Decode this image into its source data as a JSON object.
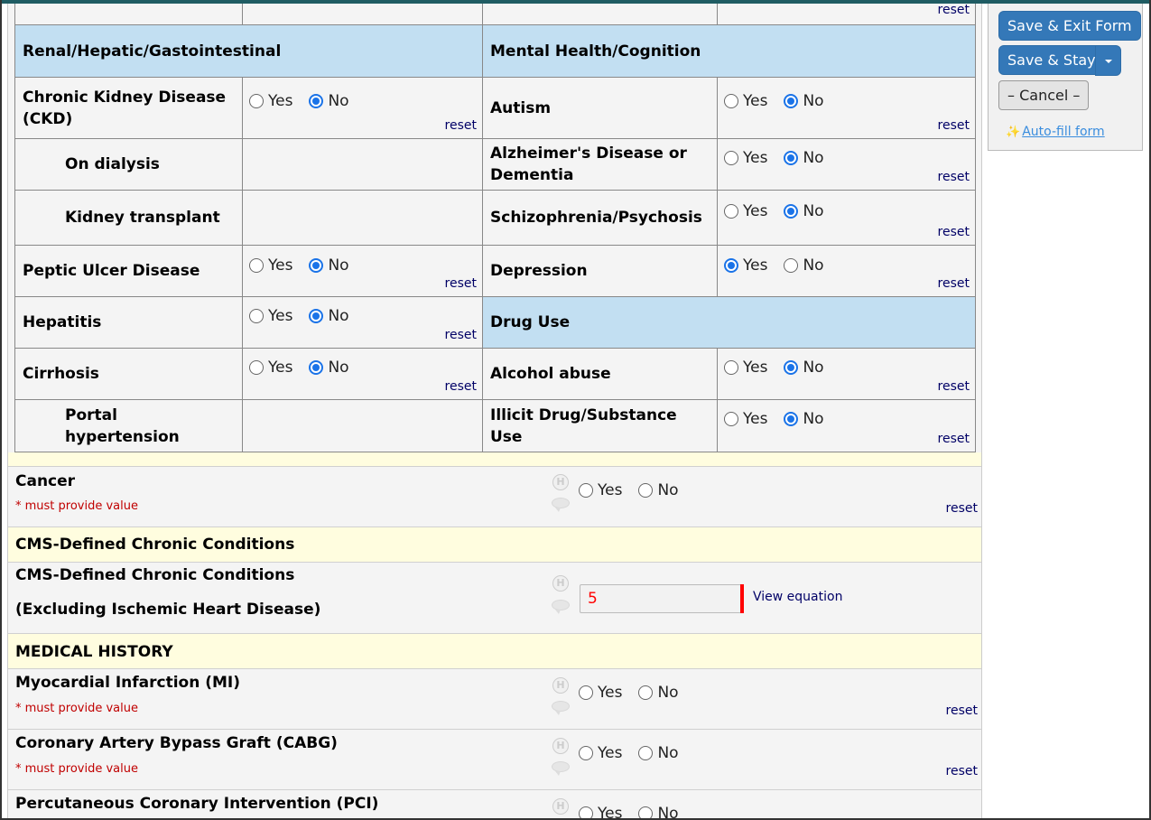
{
  "matrix": {
    "left_header": "Renal/Hepatic/Gastointestinal",
    "right_header": "Mental Health/Cognition",
    "drug_header": "Drug Use",
    "yes_label": "Yes",
    "no_label": "No",
    "reset_label": "reset",
    "left_rows": [
      {
        "label": "Chronic Kidney Disease (CKD)",
        "value": "No",
        "has_options": true,
        "indent": false
      },
      {
        "label": "On dialysis",
        "value": "",
        "has_options": false,
        "indent": true
      },
      {
        "label": "Kidney transplant",
        "value": "",
        "has_options": false,
        "indent": true
      },
      {
        "label": "Peptic Ulcer Disease",
        "value": "No",
        "has_options": true,
        "indent": false
      },
      {
        "label": "Hepatitis",
        "value": "No",
        "has_options": true,
        "indent": false
      },
      {
        "label": "Cirrhosis",
        "value": "No",
        "has_options": true,
        "indent": false
      },
      {
        "label": "Portal hypertension",
        "value": "",
        "has_options": false,
        "indent": true
      }
    ],
    "right_rows": [
      {
        "label": "Autism",
        "value": "No"
      },
      {
        "label": "Alzheimer's Disease or Dementia",
        "value": "No"
      },
      {
        "label": "Schizophrenia/Psychosis",
        "value": "No"
      },
      {
        "label": "Depression",
        "value": "Yes"
      }
    ],
    "drug_rows": [
      {
        "label": "Alcohol abuse",
        "value": "No"
      },
      {
        "label": "Illicit Drug/Substance Use",
        "value": "No"
      }
    ]
  },
  "fields": {
    "cancer": {
      "label": "Cancer",
      "required": "* must provide value",
      "yes": "Yes",
      "no": "No",
      "reset": "reset",
      "value": ""
    },
    "cms_section": "CMS-Defined Chronic Conditions",
    "cms_calc": {
      "label_line1": "CMS-Defined Chronic Conditions",
      "label_line2": "(Excluding Ischemic Heart Disease)",
      "value": "5",
      "view_equation": "View equation"
    },
    "med_history_section": "MEDICAL HISTORY",
    "mi": {
      "label": "Myocardial Infarction (MI)",
      "required": "* must provide value",
      "yes": "Yes",
      "no": "No",
      "reset": "reset",
      "value": ""
    },
    "cabg": {
      "label": "Coronary Artery Bypass Graft (CABG)",
      "required": "* must provide value",
      "yes": "Yes",
      "no": "No",
      "reset": "reset",
      "value": ""
    },
    "pci": {
      "label": "Percutaneous Coronary Intervention (PCI)",
      "yes": "Yes",
      "no": "No",
      "value": ""
    }
  },
  "panel": {
    "save_exit": "Save & Exit Form",
    "save_stay": "Save & Stay",
    "cancel": "– Cancel –",
    "autofill": "Auto-fill form"
  },
  "colors": {
    "matrix_header_bg": "#c2dff2",
    "section_bg": "#fffddf",
    "button_blue": "#3478b8",
    "radio_selected": "#1a73e8",
    "required_text": "#c00000",
    "calc_value": "#ff0000"
  }
}
